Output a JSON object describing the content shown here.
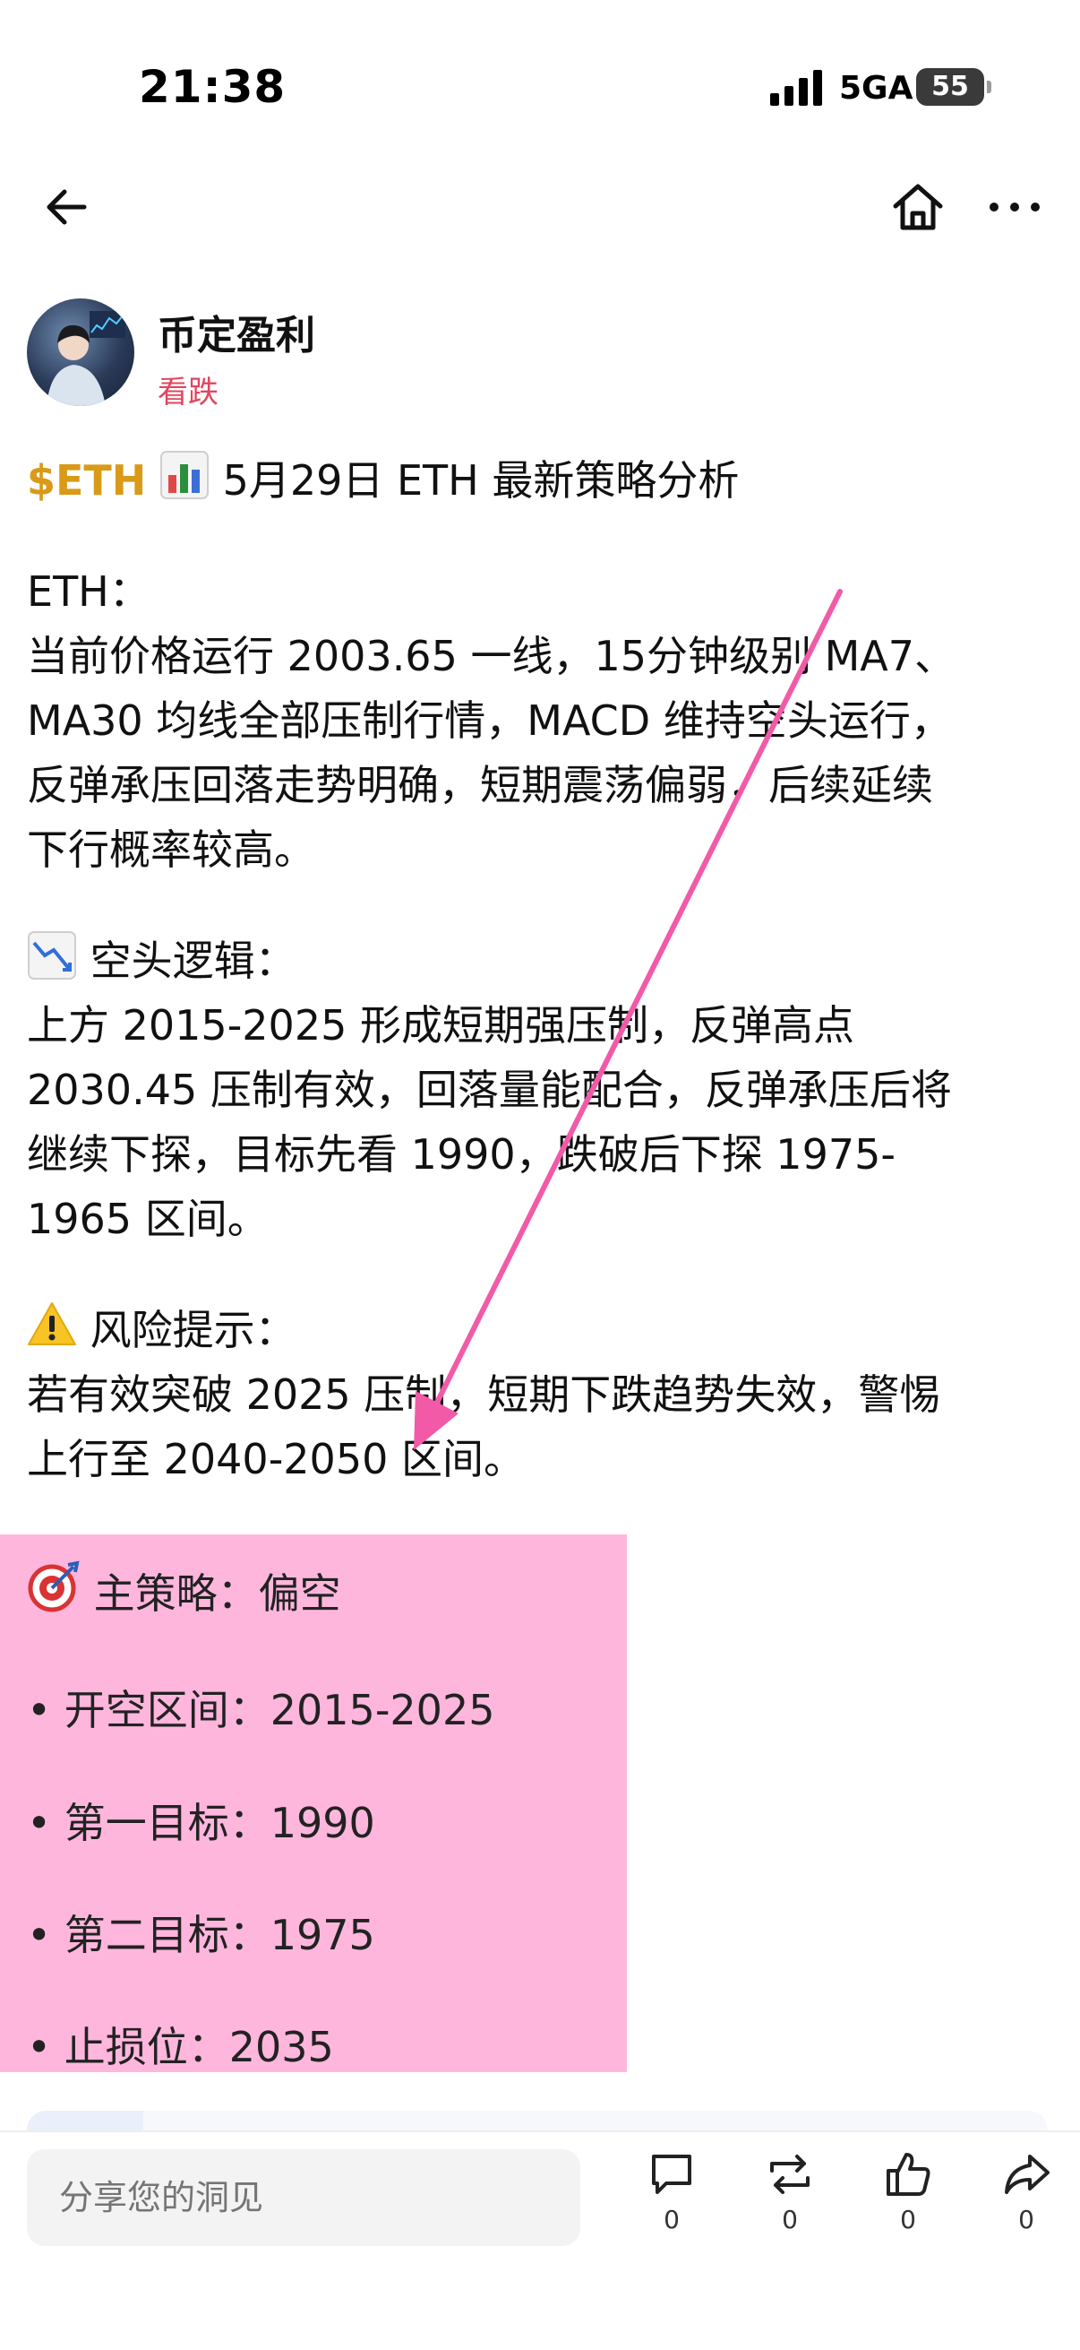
{
  "status": {
    "time": "21:38",
    "network": "5GA",
    "battery": "55"
  },
  "author": {
    "name": "币定盈利",
    "tag": "看跌"
  },
  "post": {
    "ticker": "$ETH",
    "title": "5月29日 ETH 最新策略分析",
    "eth_label": "ETH：",
    "eth_lines": [
      "当前价格运行 2003.65 一线，15分钟级别 MA7、",
      "MA30 均线全部压制行情，MACD 维持空头运行，",
      "反弹承压回落走势明确，短期震荡偏弱，后续延续",
      "下行概率较高。"
    ],
    "bear_heading": "空头逻辑：",
    "bear_lines": [
      "上方 2015-2025 形成短期强压制，反弹高点",
      "2030.45 压制有效，回落量能配合，反弹承压后将",
      "继续下探，目标先看 1990，跌破后下探 1975-",
      "1965 区间。"
    ],
    "risk_heading": "风险提示：",
    "risk_lines": [
      "若有效突破 2025 压制，短期下跌趋势失效，警惕",
      "上行至 2040-2050 区间。"
    ],
    "strategy": {
      "main": "主策略：偏空",
      "items": [
        "• 开空区间：2015-2025",
        "• 第一目标：1990",
        "• 第二目标：1975",
        "• 止损位：2035"
      ]
    }
  },
  "bottom_bar": {
    "comment_placeholder": "分享您的洞见",
    "comment_count": "0",
    "repost_count": "0",
    "like_count": "0",
    "share_count": "0"
  },
  "colors": {
    "ticker": "#d99a18",
    "tag": "#e2455f",
    "highlight": "#ffb6dd",
    "arrow": "#f25aa8"
  },
  "icons": [
    "back-arrow-icon",
    "home-icon",
    "more-icon",
    "chart-bar-icon",
    "chart-down-icon",
    "warning-icon",
    "target-icon",
    "comment-icon",
    "repost-icon",
    "like-icon",
    "share-icon"
  ]
}
